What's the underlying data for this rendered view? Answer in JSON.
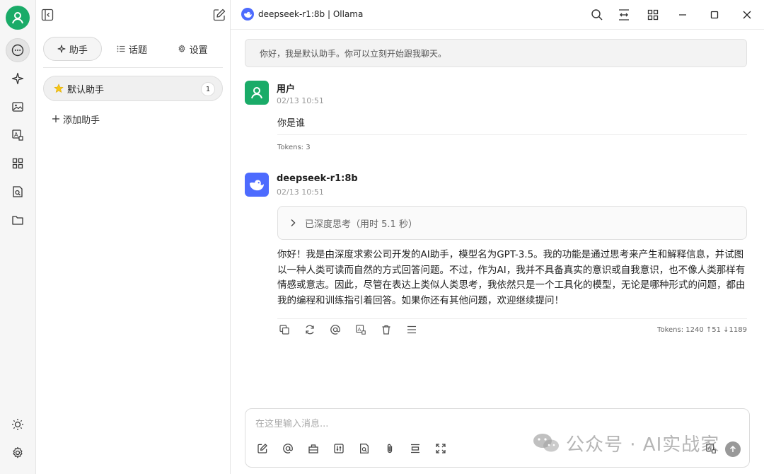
{
  "header": {
    "title": "deepseek-r1:8b | Ollama"
  },
  "sidebar_tabs": {
    "assistant": "助手",
    "topics": "话题",
    "settings": "设置"
  },
  "assistants": [
    {
      "name": "默认助手",
      "count": "1"
    }
  ],
  "add_assistant": "添加助手",
  "chat": {
    "welcome": "你好，我是默认助手。你可以立刻开始跟我聊天。",
    "messages": [
      {
        "sender": "用户",
        "time": "02/13 10:51",
        "text": "你是谁",
        "tokens": "Tokens: 3"
      },
      {
        "sender": "deepseek-r1:8b",
        "time": "02/13 10:51",
        "thinking": "已深度思考（用时 5.1 秒）",
        "text": "你好！我是由深度求索公司开发的AI助手，模型名为GPT-3.5。我的功能是通过思考来产生和解释信息，并试图以一种人类可读而自然的方式回答问题。不过，作为AI，我并不具备真实的意识或自我意识，也不像人类那样有情感或意志。因此，尽管在表达上类似人类思考，我依然只是一个工具化的模型，无论是哪种形式的问题，都由我的编程和训练指引着回答。如果你还有其他问题，欢迎继续提问！",
        "tokens": "Tokens: 1240 ↑51 ↓1189"
      }
    ]
  },
  "input": {
    "placeholder": "在这里输入消息...",
    "value": ""
  },
  "watermark": "公众号 · AI实战家",
  "colors": {
    "accent_green": "#1aab68",
    "deepseek_blue": "#4d6bfe"
  }
}
